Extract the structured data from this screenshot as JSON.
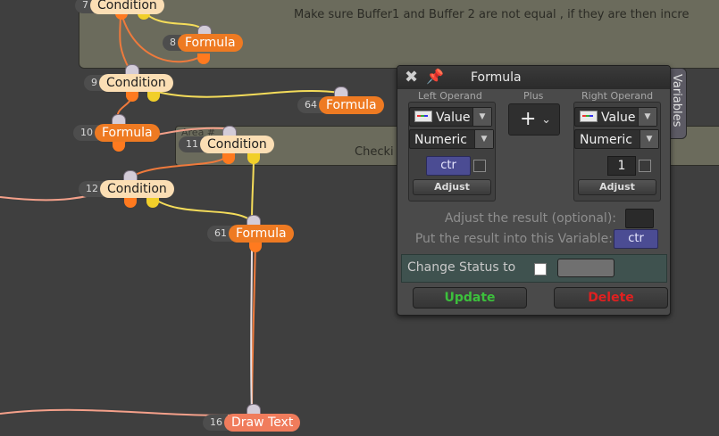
{
  "areas": [
    {
      "text": "Make sure Buffer1 and Buffer 2 are not equal , if they are then incre"
    },
    {
      "title": "Area #",
      "text": "Checki"
    }
  ],
  "nodes": [
    {
      "id": "n7",
      "num": "7",
      "label": "Condition",
      "kind": "condition"
    },
    {
      "id": "n8",
      "num": "8",
      "label": "Formula",
      "kind": "formula"
    },
    {
      "id": "n9",
      "num": "9",
      "label": "Condition",
      "kind": "condition"
    },
    {
      "id": "n64",
      "num": "64",
      "label": "Formula",
      "kind": "formula"
    },
    {
      "id": "n10",
      "num": "10",
      "label": "Formula",
      "kind": "formula"
    },
    {
      "id": "n11",
      "num": "11",
      "label": "Condition",
      "kind": "condition"
    },
    {
      "id": "n12",
      "num": "12",
      "label": "Condition",
      "kind": "condition"
    },
    {
      "id": "n61",
      "num": "61",
      "label": "Formula",
      "kind": "formula"
    },
    {
      "id": "n16",
      "num": "16",
      "label": "Draw Text",
      "kind": "draw-text"
    }
  ],
  "side_tab": {
    "label": "Variables"
  },
  "dialog": {
    "title": "Formula",
    "left_operand": {
      "heading": "Left Operand",
      "source": "Value",
      "type": "Numeric",
      "variable": "ctr",
      "adjust": "Adjust"
    },
    "operator": {
      "heading": "Plus",
      "symbol": "+"
    },
    "right_operand": {
      "heading": "Right Operand",
      "source": "Value",
      "type": "Numeric",
      "value": "1",
      "adjust": "Adjust"
    },
    "adjust_result_label": "Adjust the result (optional):",
    "result_var_label": "Put the result into this Variable:",
    "result_var": "ctr",
    "change_status_label": "Change Status to",
    "update_label": "Update",
    "delete_label": "Delete"
  },
  "colors": {
    "canvas": "#3f3f3f",
    "condition_node": "#fbdeb4",
    "formula_node": "#ee7a22",
    "draw_text_node": "#f07c5c",
    "wire_orange": "#ef7a3c",
    "wire_yellow": "#f4dc5a",
    "wire_salmon": "#f4a08a",
    "variable_field": "#4b4c93",
    "update_text": "#3cc03c",
    "delete_text": "#e02020"
  }
}
